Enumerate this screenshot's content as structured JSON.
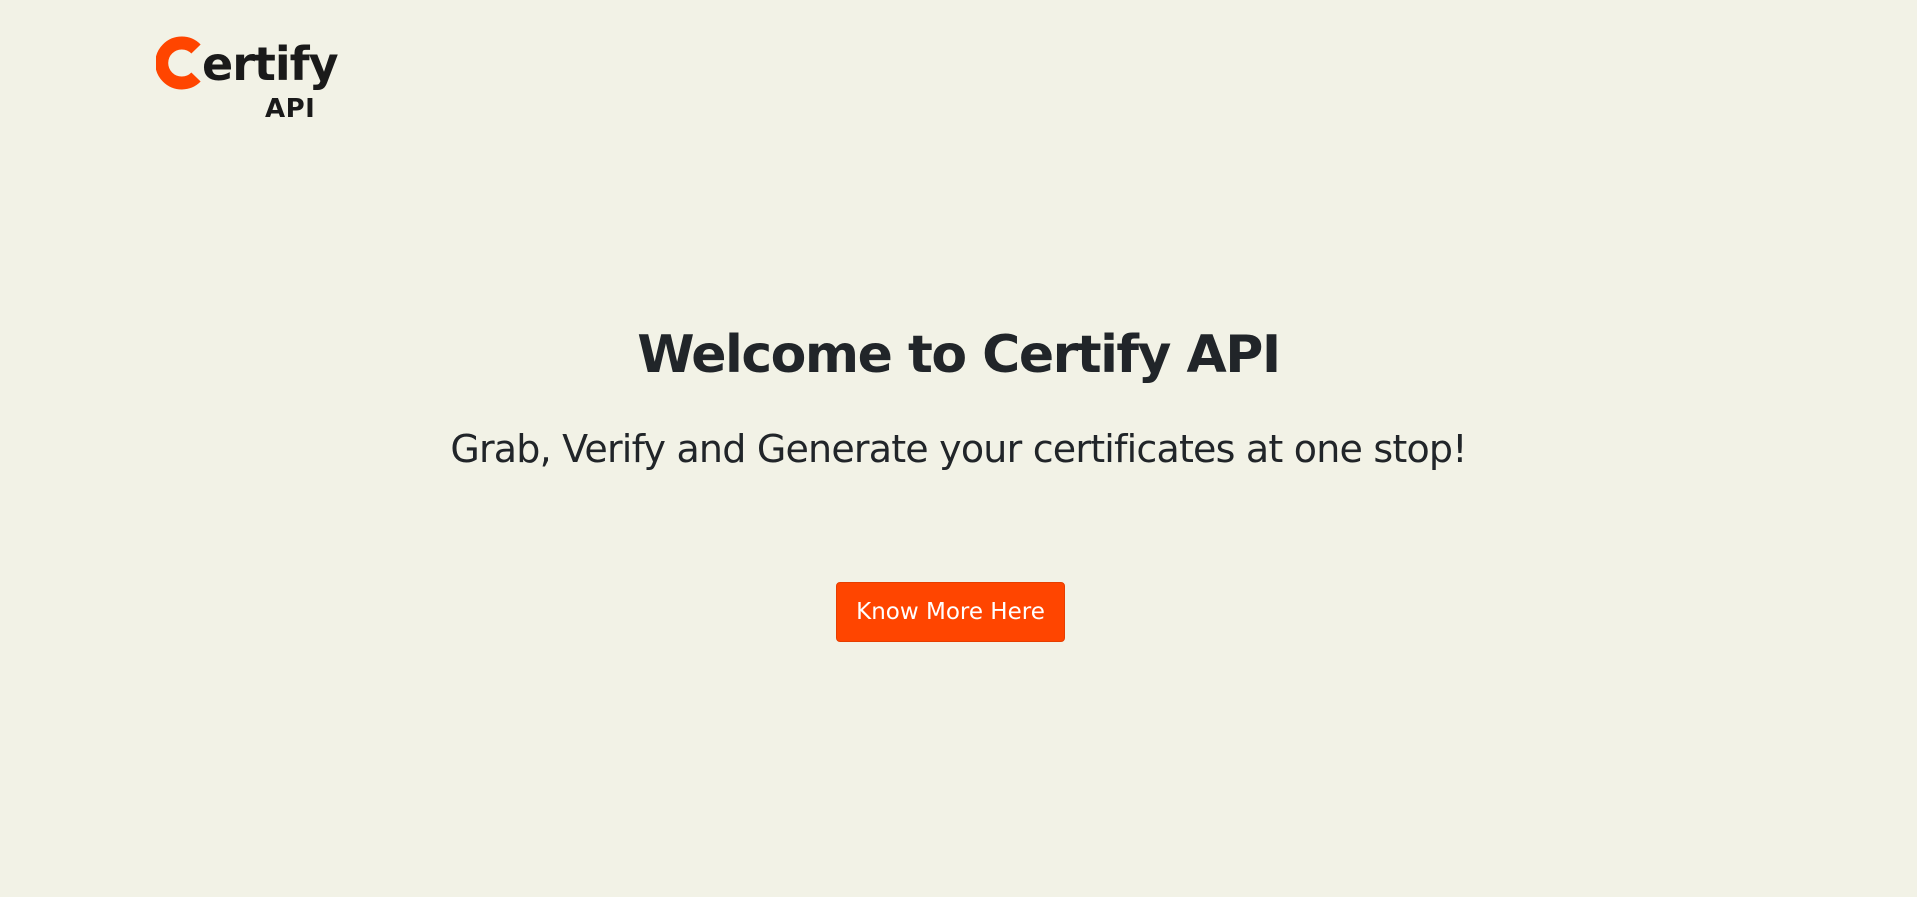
{
  "logo": {
    "word": "ertify",
    "mark_letter": "C",
    "sub": "API",
    "mark_color": "#ff4500"
  },
  "hero": {
    "title": "Welcome to Certify API",
    "subtitle": "Grab, Verify and Generate your certificates at one stop!"
  },
  "cta": {
    "label": "Know More Here",
    "color": "#ff4500"
  },
  "page": {
    "background": "#f2f2e6"
  }
}
